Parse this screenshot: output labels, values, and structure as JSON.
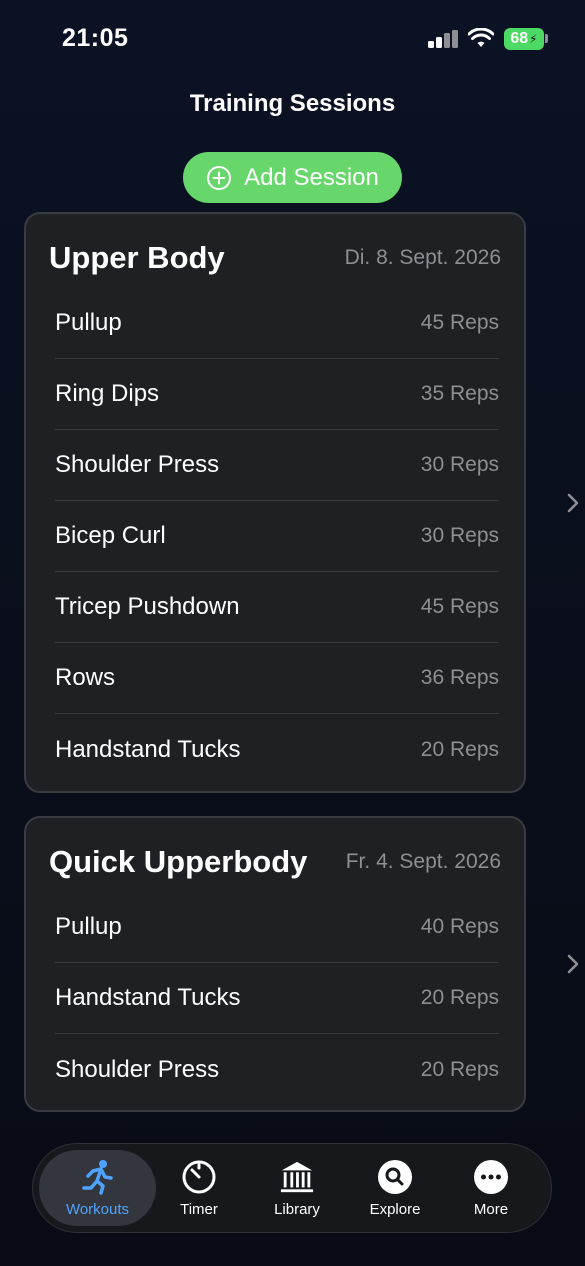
{
  "status_bar": {
    "time": "21:05",
    "battery": "68"
  },
  "header": {
    "title": "Training Sessions"
  },
  "add_button": {
    "label": "Add Session"
  },
  "sessions": [
    {
      "title": "Upper Body",
      "date": "Di. 8. Sept. 2026",
      "exercises": [
        {
          "name": "Pullup",
          "reps": "45 Reps"
        },
        {
          "name": "Ring Dips",
          "reps": "35 Reps"
        },
        {
          "name": "Shoulder Press",
          "reps": "30 Reps"
        },
        {
          "name": "Bicep Curl",
          "reps": "30 Reps"
        },
        {
          "name": "Tricep Pushdown",
          "reps": "45 Reps"
        },
        {
          "name": "Rows",
          "reps": "36 Reps"
        },
        {
          "name": "Handstand Tucks",
          "reps": "20 Reps"
        }
      ]
    },
    {
      "title": "Quick Upperbody",
      "date": "Fr. 4. Sept. 2026",
      "exercises": [
        {
          "name": "Pullup",
          "reps": "40 Reps"
        },
        {
          "name": "Handstand Tucks",
          "reps": "20 Reps"
        },
        {
          "name": "Shoulder Press",
          "reps": "20 Reps"
        }
      ]
    }
  ],
  "tab_bar": {
    "tabs": [
      {
        "label": "Workouts",
        "icon": "running-person-icon",
        "active": true
      },
      {
        "label": "Timer",
        "icon": "timer-icon",
        "active": false
      },
      {
        "label": "Library",
        "icon": "library-building-icon",
        "active": false
      },
      {
        "label": "Explore",
        "icon": "search-icon",
        "active": false
      },
      {
        "label": "More",
        "icon": "more-dots-icon",
        "active": false
      }
    ]
  },
  "colors": {
    "accent_green": "#67d76b",
    "accent_blue": "#4ea3ff",
    "card_background": "#1f2024",
    "secondary_text": "#8e8e93"
  }
}
